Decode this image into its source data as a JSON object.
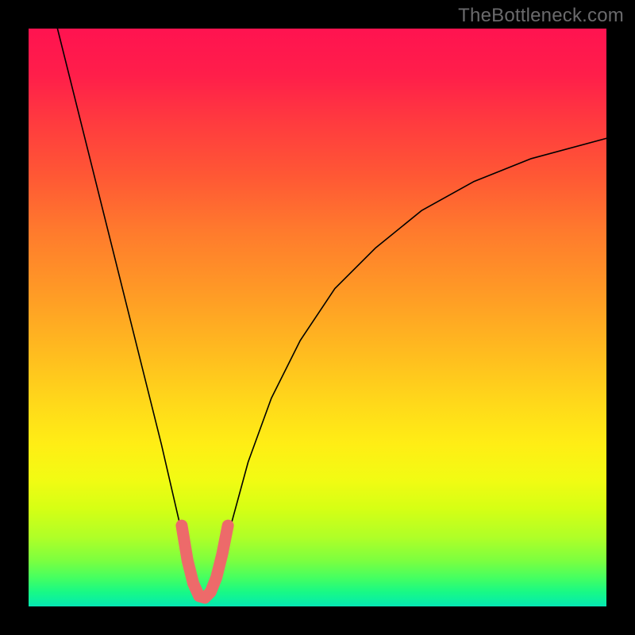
{
  "watermark": "TheBottleneck.com",
  "chart_data": {
    "type": "line",
    "title": "",
    "xlabel": "",
    "ylabel": "",
    "xlim": [
      0,
      100
    ],
    "ylim": [
      0,
      100
    ],
    "background_gradient": {
      "direction": "vertical",
      "stops": [
        {
          "pos": 0,
          "color": "#ff1350"
        },
        {
          "pos": 0.25,
          "color": "#ff5635"
        },
        {
          "pos": 0.55,
          "color": "#ffb820"
        },
        {
          "pos": 0.78,
          "color": "#f2fb13"
        },
        {
          "pos": 0.92,
          "color": "#7dff3f"
        },
        {
          "pos": 1.0,
          "color": "#06e6b3"
        }
      ]
    },
    "series": [
      {
        "name": "bottleneck-curve",
        "x": [
          5,
          8,
          11,
          14,
          17,
          20,
          23,
          26,
          28.5,
          30,
          31.5,
          33,
          35,
          38,
          42,
          47,
          53,
          60,
          68,
          77,
          87,
          100
        ],
        "y": [
          100,
          88,
          76,
          64,
          52,
          40,
          28,
          15,
          6,
          1.5,
          1.5,
          6,
          14,
          25,
          36,
          46,
          55,
          62,
          68.5,
          73.5,
          77.5,
          81
        ]
      }
    ],
    "highlight_segment": {
      "series": "bottleneck-curve",
      "x": [
        26.5,
        27.5,
        28.5,
        29.5,
        30.5,
        31.5,
        32.5,
        33.5,
        34.5
      ],
      "y": [
        14,
        8,
        4,
        1.8,
        1.5,
        2.5,
        5,
        9,
        14
      ],
      "color": "#ed6a6a"
    }
  }
}
